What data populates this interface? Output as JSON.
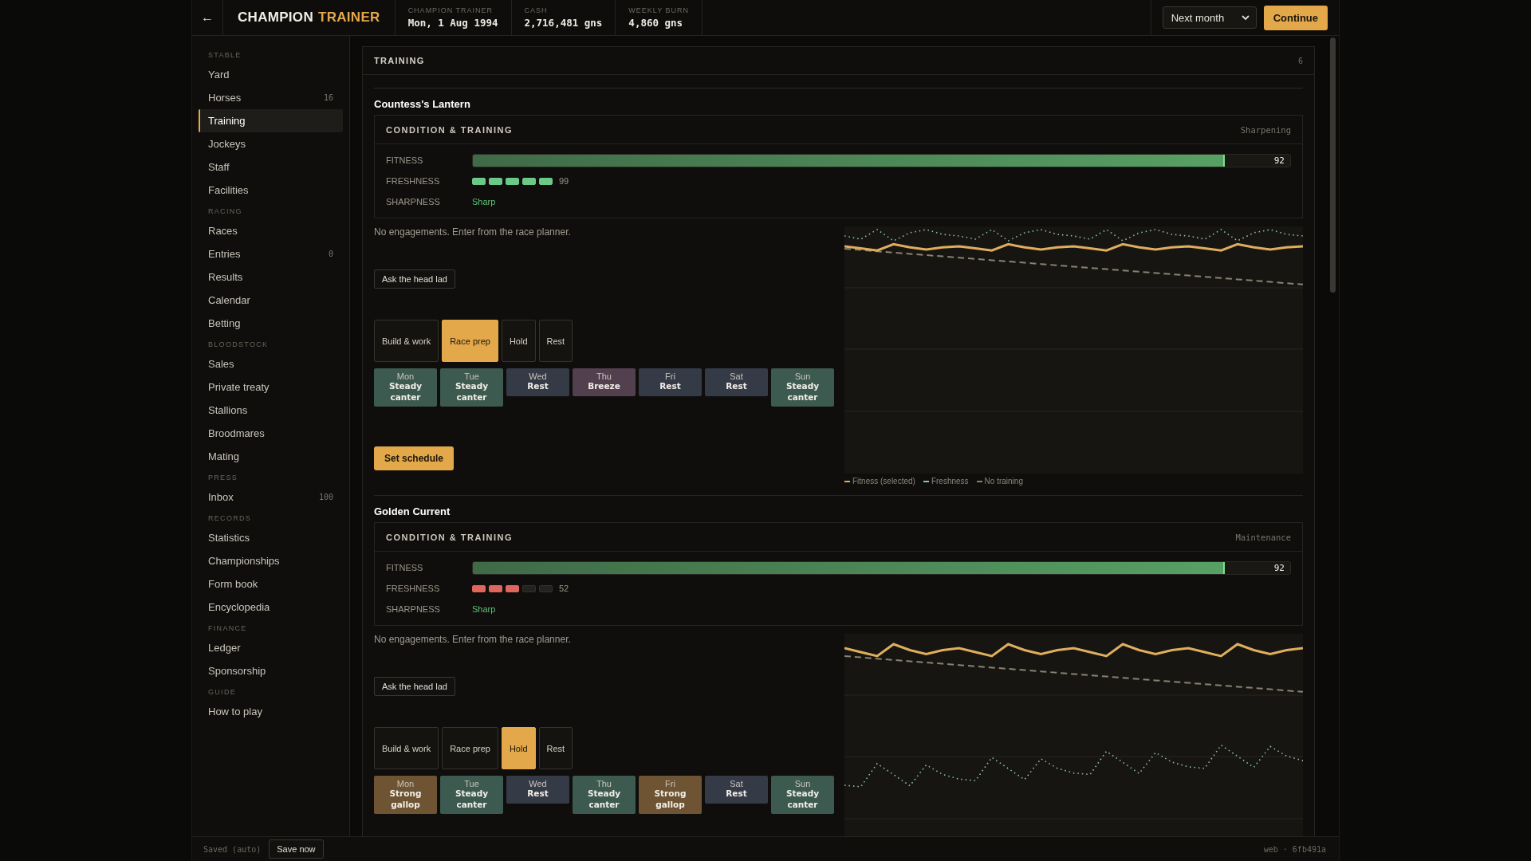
{
  "topbar": {
    "back": "←",
    "logo": {
      "first": "CHAMPION",
      "second": "TRAINER"
    },
    "stats": [
      {
        "label": "CHAMPION TRAINER",
        "value": "Mon, 1 Aug 1994"
      },
      {
        "label": "CASH",
        "value": "2,716,481 gns"
      },
      {
        "label": "WEEKLY BURN",
        "value": "4,860 gns"
      }
    ],
    "advance": {
      "value": "Next month"
    },
    "continue": "Continue"
  },
  "sidebar": [
    {
      "heading": "STABLE",
      "items": [
        {
          "label": "Yard",
          "selected": false
        },
        {
          "label": "Horses",
          "count": "16",
          "selected": false
        },
        {
          "label": "Training",
          "selected": true
        },
        {
          "label": "Jockeys",
          "selected": false
        },
        {
          "label": "Staff",
          "selected": false
        },
        {
          "label": "Facilities",
          "selected": false
        }
      ]
    },
    {
      "heading": "RACING",
      "items": [
        {
          "label": "Races",
          "selected": false
        },
        {
          "label": "Entries",
          "count": "0",
          "selected": false
        },
        {
          "label": "Results",
          "selected": false
        },
        {
          "label": "Calendar",
          "selected": false
        },
        {
          "label": "Betting",
          "selected": false
        }
      ]
    },
    {
      "heading": "BLOODSTOCK",
      "items": [
        {
          "label": "Sales",
          "selected": false
        },
        {
          "label": "Private treaty",
          "selected": false
        },
        {
          "label": "Stallions",
          "selected": false
        },
        {
          "label": "Broodmares",
          "selected": false
        },
        {
          "label": "Mating",
          "selected": false
        }
      ]
    },
    {
      "heading": "PRESS",
      "items": [
        {
          "label": "Inbox",
          "count": "100",
          "selected": false
        }
      ]
    },
    {
      "heading": "RECORDS",
      "items": [
        {
          "label": "Statistics",
          "selected": false
        },
        {
          "label": "Championships",
          "selected": false
        },
        {
          "label": "Form book",
          "selected": false
        },
        {
          "label": "Encyclopedia",
          "selected": false
        }
      ]
    },
    {
      "heading": "FINANCE",
      "items": [
        {
          "label": "Ledger",
          "selected": false
        },
        {
          "label": "Sponsorship",
          "selected": false
        }
      ]
    },
    {
      "heading": "GUIDE",
      "items": [
        {
          "label": "How to play",
          "selected": false
        }
      ]
    }
  ],
  "panel": {
    "title": "TRAINING",
    "count": "6",
    "horses": [
      {
        "name": "Countess's Lantern",
        "card_title": "CONDITION & TRAINING",
        "status": "Sharpening",
        "fitness": {
          "label": "FITNESS",
          "level": 0.92,
          "reading": "92"
        },
        "freshness": {
          "label": "FRESHNESS",
          "stars": 5,
          "color": "#6bc987",
          "reading": "99"
        },
        "sharpness": {
          "label": "SHARPNESS",
          "value": "Sharp"
        },
        "note": "No engagements. Enter from the race planner.",
        "ask": "Ask the head lad",
        "plans": [
          {
            "label": "Build & work",
            "selected": false
          },
          {
            "label": "Race prep",
            "selected": true
          },
          {
            "label": "Hold",
            "selected": false
          },
          {
            "label": "Rest",
            "selected": false
          }
        ],
        "days": [
          {
            "day": "Mon",
            "work": "Steady canter",
            "kind": "canter"
          },
          {
            "day": "Tue",
            "work": "Steady canter",
            "kind": "canter"
          },
          {
            "day": "Wed",
            "work": "Rest",
            "kind": "rest"
          },
          {
            "day": "Thu",
            "work": "Breeze",
            "kind": "breeze"
          },
          {
            "day": "Fri",
            "work": "Rest",
            "kind": "rest"
          },
          {
            "day": "Sat",
            "work": "Rest",
            "kind": "rest"
          },
          {
            "day": "Sun",
            "work": "Steady canter",
            "kind": "canter"
          }
        ],
        "set": "Set schedule",
        "legend": [
          "Fitness (selected)",
          "Freshness",
          "No training"
        ]
      },
      {
        "name": "Golden Current",
        "card_title": "CONDITION & TRAINING",
        "status": "Maintenance",
        "fitness": {
          "label": "FITNESS",
          "level": 0.92,
          "reading": "92"
        },
        "freshness": {
          "label": "FRESHNESS",
          "stars": 3,
          "color": "#de665c",
          "reading": "52"
        },
        "sharpness": {
          "label": "SHARPNESS",
          "value": "Sharp"
        },
        "note": "No engagements. Enter from the race planner.",
        "ask": "Ask the head lad",
        "plans": [
          {
            "label": "Build & work",
            "selected": false
          },
          {
            "label": "Race prep",
            "selected": false
          },
          {
            "label": "Hold",
            "selected": true
          },
          {
            "label": "Rest",
            "selected": false
          }
        ],
        "days": [
          {
            "day": "Mon",
            "work": "Strong gallop",
            "kind": "gallop"
          },
          {
            "day": "Tue",
            "work": "Steady canter",
            "kind": "canter"
          },
          {
            "day": "Wed",
            "work": "Rest",
            "kind": "rest"
          },
          {
            "day": "Thu",
            "work": "Steady canter",
            "kind": "canter"
          },
          {
            "day": "Fri",
            "work": "Strong gallop",
            "kind": "gallop"
          },
          {
            "day": "Sat",
            "work": "Rest",
            "kind": "rest"
          },
          {
            "day": "Sun",
            "work": "Steady canter",
            "kind": "canter"
          }
        ]
      }
    ]
  },
  "footer": {
    "saved": "Saved (auto)",
    "save": "Save now",
    "build": "web · 6fb491a"
  }
}
